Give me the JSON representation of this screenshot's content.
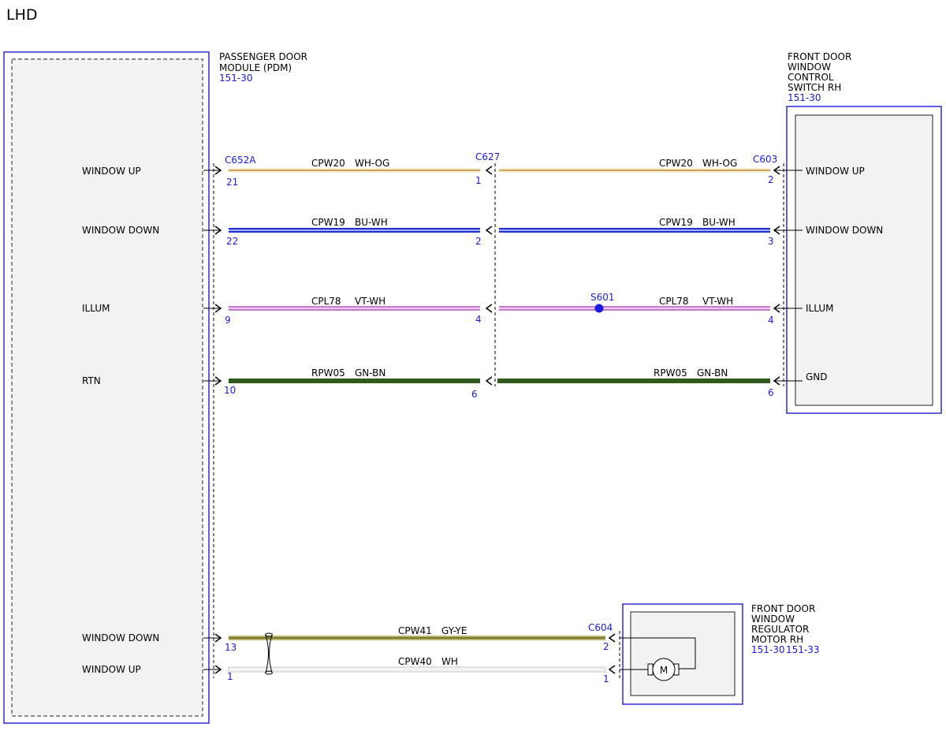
{
  "page": {
    "title": "LHD"
  },
  "colors": {
    "outline_blue": "#2b2bd6",
    "ref_blue": "#1a1adc",
    "module_fill": "#f2f2f2",
    "wire_wh_og": {
      "base": "#fbf0dc",
      "stripe": "#d4a24c"
    },
    "wire_bu_wh": {
      "base": "#1f2fd0",
      "stripe": "#d8dcff"
    },
    "wire_vt_wh": {
      "base": "#c77ad0",
      "stripe": "#f6e4f8"
    },
    "wire_gn_bn": {
      "base": "#2f5c1c",
      "stripe": "#2f5c1c"
    },
    "wire_gy_ye": {
      "base": "#b9b96e",
      "stripe": "#6b5a20"
    },
    "wire_wh": {
      "base": "#f4f4f4",
      "stripe": "#cfcfcf"
    }
  },
  "components": {
    "pdm": {
      "name_lines": [
        "PASSENGER DOOR",
        "MODULE (PDM)"
      ],
      "ref": "151-30"
    },
    "switch": {
      "name_lines": [
        "FRONT DOOR",
        "WINDOW",
        "CONTROL",
        "SWITCH RH"
      ],
      "ref": "151-30"
    },
    "motor": {
      "name_lines": [
        "FRONT DOOR",
        "WINDOW",
        "REGULATOR",
        "MOTOR RH"
      ],
      "refs": [
        "151-30",
        "151-33"
      ],
      "symbol": "M"
    }
  },
  "connectors": {
    "pdm": "C652A",
    "inline": "C627",
    "switch": "C603",
    "motor": "C604",
    "splice": "S601"
  },
  "circuits": [
    {
      "id": "window-up",
      "pdm_label": "WINDOW UP",
      "switch_label": "WINDOW UP",
      "circuit": "CPW20",
      "color": "WH-OG",
      "pdm_pin": "21",
      "inline_pin": "1",
      "switch_pin": "2"
    },
    {
      "id": "window-down",
      "pdm_label": "WINDOW DOWN",
      "switch_label": "WINDOW DOWN",
      "circuit": "CPW19",
      "color": "BU-WH",
      "pdm_pin": "22",
      "inline_pin": "2",
      "switch_pin": "3"
    },
    {
      "id": "illum",
      "pdm_label": "ILLUM",
      "switch_label": "ILLUM",
      "circuit": "CPL78",
      "color": "VT-WH",
      "pdm_pin": "9",
      "inline_pin": "4",
      "switch_pin": "4"
    },
    {
      "id": "rtn",
      "pdm_label": "RTN",
      "switch_label": "GND",
      "circuit": "RPW05",
      "color": "GN-BN",
      "pdm_pin": "10",
      "inline_pin": "6",
      "switch_pin": "6"
    }
  ],
  "motor_circuits": [
    {
      "id": "motor-window-down",
      "pdm_label": "WINDOW DOWN",
      "circuit": "CPW41",
      "color": "GY-YE",
      "pdm_pin": "13",
      "motor_pin": "2"
    },
    {
      "id": "motor-window-up",
      "pdm_label": "WINDOW UP",
      "circuit": "CPW40",
      "color": "WH",
      "pdm_pin": "1",
      "motor_pin": "1"
    }
  ]
}
